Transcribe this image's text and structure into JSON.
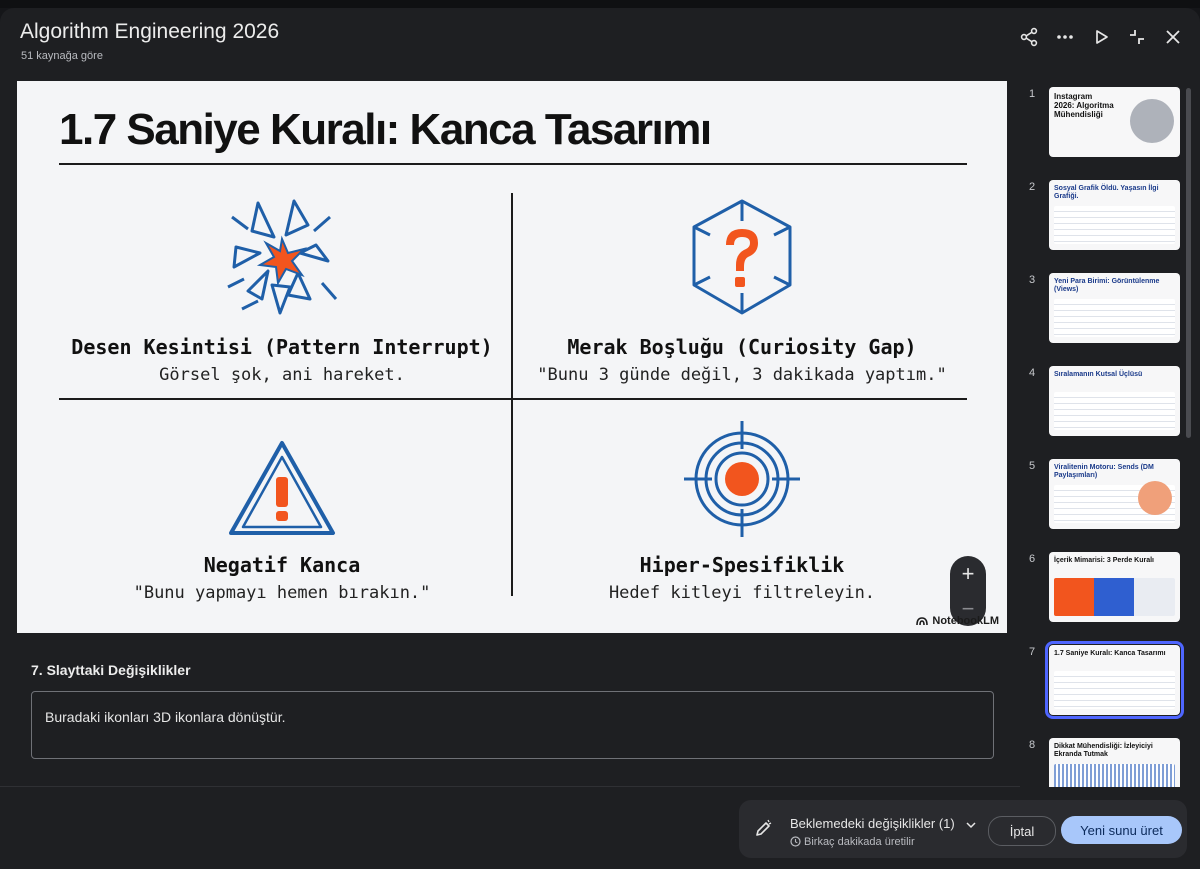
{
  "header": {
    "title": "Algorithm Engineering 2026",
    "subtitle": "51 kaynağa göre",
    "icons": [
      "share-icon",
      "more-icon",
      "play-icon",
      "collapse-icon",
      "close-icon"
    ]
  },
  "slide": {
    "title": "1.7 Saniye Kuralı: Kanca Tasarımı",
    "quadrants": [
      {
        "heading": "Desen Kesintisi (Pattern Interrupt)",
        "desc": "Görsel şok, ani hareket.",
        "icon": "shattered-glass-icon"
      },
      {
        "heading": "Merak Boşluğu (Curiosity Gap)",
        "desc": "\"Bunu 3 günde değil, 3 dakikada yaptım.\"",
        "icon": "question-cube-icon"
      },
      {
        "heading": "Negatif Kanca",
        "desc": "\"Bunu yapmayı hemen bırakın.\"",
        "icon": "warning-triangle-icon"
      },
      {
        "heading": "Hiper-Spesifiklik",
        "desc": "Hedef kitleyi filtreleyin.",
        "icon": "target-icon"
      }
    ],
    "brand": "NotebookLM",
    "zoom_in": "+",
    "zoom_out": "−"
  },
  "notes": {
    "label": "7. Slayttaki Değişiklikler",
    "text": "Buradaki ikonları 3D ikonlara dönüştür."
  },
  "pending": {
    "title": "Beklemedeki değişiklikler (1)",
    "subtitle": "Birkaç dakikada üretilir",
    "cancel_label": "İptal",
    "generate_label": "Yeni sunu üret"
  },
  "thumbnails": [
    {
      "num": "1",
      "title": "Instagram 2026: Algoritma Mühendisliği"
    },
    {
      "num": "2",
      "title": "Sosyal Grafik Öldü. Yaşasın İlgi Grafiği."
    },
    {
      "num": "3",
      "title": "Yeni Para Birimi: Görüntülenme (Views)"
    },
    {
      "num": "4",
      "title": "Sıralamanın Kutsal Üçlüsü"
    },
    {
      "num": "5",
      "title": "Viralitenin Motoru: Sends (DM Paylaşımları)"
    },
    {
      "num": "6",
      "title": "İçerik Mimarisi: 3 Perde Kuralı"
    },
    {
      "num": "7",
      "title": "1.7 Saniye Kuralı: Kanca Tasarımı"
    },
    {
      "num": "8",
      "title": "Dikkat Mühendisliği: İzleyiciyi Ekranda Tutmak"
    }
  ]
}
